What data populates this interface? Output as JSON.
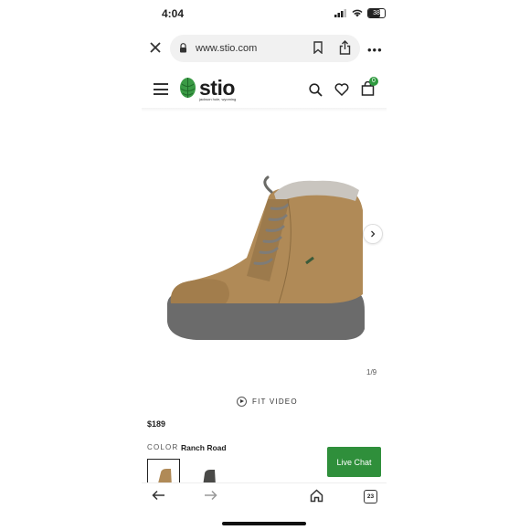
{
  "status_bar": {
    "time": "4:04",
    "battery": "38",
    "icons": [
      "signal-icon",
      "wifi-icon",
      "battery-icon"
    ]
  },
  "browser": {
    "url": "www.stio.com",
    "tab_count": "23",
    "icons": [
      "close-icon",
      "lock-icon",
      "bookmark-icon",
      "share-icon",
      "more-icon",
      "back-icon",
      "forward-icon",
      "home-icon",
      "tabs-icon"
    ]
  },
  "site_header": {
    "logo_text": "stio",
    "logo_tagline": "jackson hole, wyoming",
    "cart_count": "0",
    "icons": [
      "menu-icon",
      "pinecone-logo-icon",
      "search-icon",
      "heart-icon",
      "bag-icon"
    ]
  },
  "product": {
    "image_counter": "1/9",
    "fit_video_label": "FIT VIDEO",
    "price": "$189",
    "color_label": "COLOR",
    "color_value": "Ranch Road",
    "swatches": [
      "Ranch Road",
      "Dark"
    ]
  },
  "live_chat": {
    "label": "Live Chat"
  },
  "colors": {
    "brand_green": "#2f8f3b",
    "boot_tan": "#b08a57",
    "sole_gray": "#6b6b6b"
  }
}
